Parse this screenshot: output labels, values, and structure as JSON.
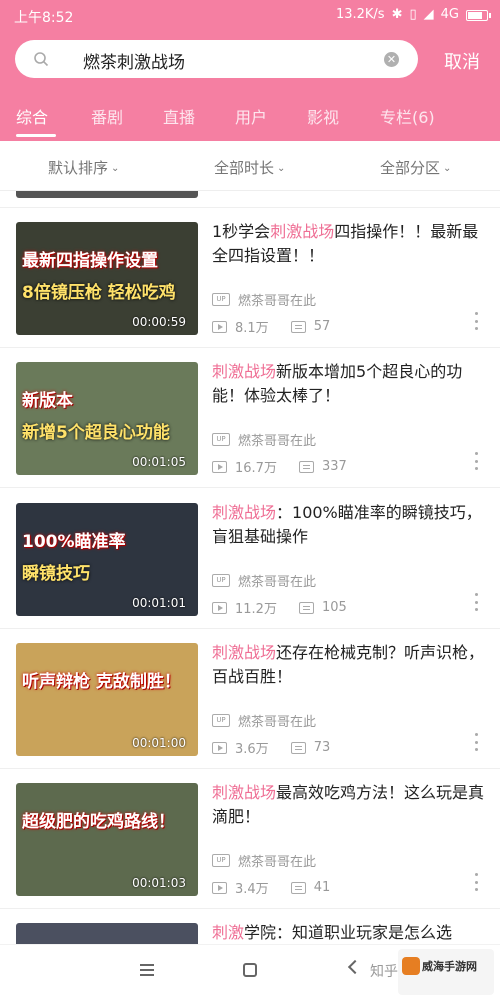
{
  "status": {
    "time": "上午8:52",
    "speed": "13.2K/s",
    "network": "4G"
  },
  "search": {
    "query": "燃茶刺激战场",
    "cancel": "取消"
  },
  "tabs": [
    "综合",
    "番剧",
    "直播",
    "用户",
    "影视",
    "专栏(6)"
  ],
  "filters": [
    "默认排序",
    "全部时长",
    "全部分区"
  ],
  "videos": [
    {
      "title_hl": "",
      "title_rest": "",
      "title_parts": [
        "1秒学会",
        "刺激战场",
        "四指操作！！最新最全四指设置！！"
      ],
      "author": "燃茶哥哥在此",
      "views": "8.1万",
      "danmaku": "57",
      "duration": "00:00:59",
      "thumb": [
        "最新四指操作设置",
        "8倍镜压枪 轻松吃鸡"
      ],
      "bg": "#3b3f33"
    },
    {
      "title_parts": [
        "",
        "刺激战场",
        "新版本增加5个超良心的功能！体验太棒了！"
      ],
      "author": "燃茶哥哥在此",
      "views": "16.7万",
      "danmaku": "337",
      "duration": "00:01:05",
      "thumb": [
        "新版本",
        "新增5个超良心功能"
      ],
      "bg": "#6a7a5a"
    },
    {
      "title_parts": [
        "",
        "刺激战场",
        "：100%瞄准率的瞬镜技巧，盲狙基础操作"
      ],
      "author": "燃茶哥哥在此",
      "views": "11.2万",
      "danmaku": "105",
      "duration": "00:01:01",
      "thumb": [
        "100%瞄准率",
        "瞬镜技巧"
      ],
      "bg": "#2e3540"
    },
    {
      "title_parts": [
        "",
        "刺激战场",
        "还存在枪械克制？听声识枪，百战百胜！"
      ],
      "author": "燃茶哥哥在此",
      "views": "3.6万",
      "danmaku": "73",
      "duration": "00:01:00",
      "thumb": [
        "听声辩枪 克敌制胜！",
        ""
      ],
      "bg": "#c9a35a"
    },
    {
      "title_parts": [
        "",
        "刺激战场",
        "最高效吃鸡方法！这么玩是真滴肥！"
      ],
      "author": "燃茶哥哥在此",
      "views": "3.4万",
      "danmaku": "41",
      "duration": "00:01:03",
      "thumb": [
        "超级肥的吃鸡路线！",
        ""
      ],
      "bg": "#5d6a4e"
    },
    {
      "title_parts": [
        "",
        "刺激",
        "学院：知道职业玩家是怎么选"
      ],
      "author": "",
      "views": "",
      "danmaku": "",
      "duration": "",
      "thumb": [
        "",
        ""
      ],
      "bg": "#4b5060"
    }
  ],
  "watermark": {
    "text": "知乎",
    "logo": "威海手游网"
  },
  "colors": {
    "brand": "#f57fa2",
    "highlight": "#ef6f95"
  }
}
